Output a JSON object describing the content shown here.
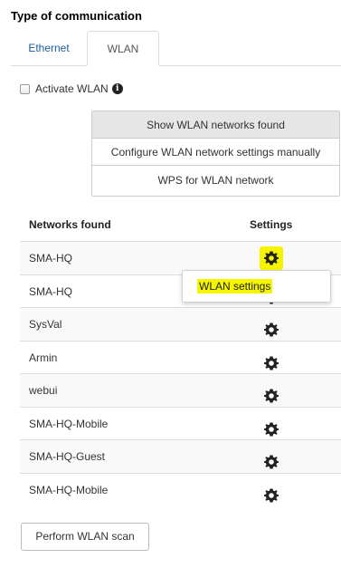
{
  "section": {
    "title": "Type of communication"
  },
  "tabs": [
    {
      "label": "Ethernet",
      "active": false
    },
    {
      "label": "WLAN",
      "active": true
    }
  ],
  "activate_wlan": {
    "label": "Activate WLAN",
    "checked": false,
    "info_icon": "info-circle-icon"
  },
  "wlan_buttons": [
    {
      "label": "Show WLAN networks found",
      "active": true
    },
    {
      "label": "Configure WLAN network settings manually",
      "active": false
    },
    {
      "label": "WPS for WLAN network",
      "active": false
    }
  ],
  "networks_table": {
    "columns": [
      "Networks found",
      "Settings"
    ],
    "rows": [
      {
        "name": "SMA-HQ",
        "settings_icon": "gear-icon"
      },
      {
        "name": "SMA-HQ",
        "settings_icon": "gear-icon"
      },
      {
        "name": "SysVal",
        "settings_icon": "gear-icon"
      },
      {
        "name": "Armin",
        "settings_icon": "gear-icon"
      },
      {
        "name": "webui",
        "settings_icon": "gear-icon"
      },
      {
        "name": "SMA-HQ-Mobile",
        "settings_icon": "gear-icon"
      },
      {
        "name": "SMA-HQ-Guest",
        "settings_icon": "gear-icon"
      },
      {
        "name": "SMA-HQ-Mobile",
        "settings_icon": "gear-icon"
      }
    ]
  },
  "context_menu": {
    "item_label": "WLAN settings",
    "highlight_color": "#f5f500"
  },
  "scan_button": {
    "label": "Perform WLAN scan"
  },
  "colors": {
    "link": "#1a5c9e",
    "highlight": "#f5f500",
    "active_button": "#e6e6e6"
  }
}
